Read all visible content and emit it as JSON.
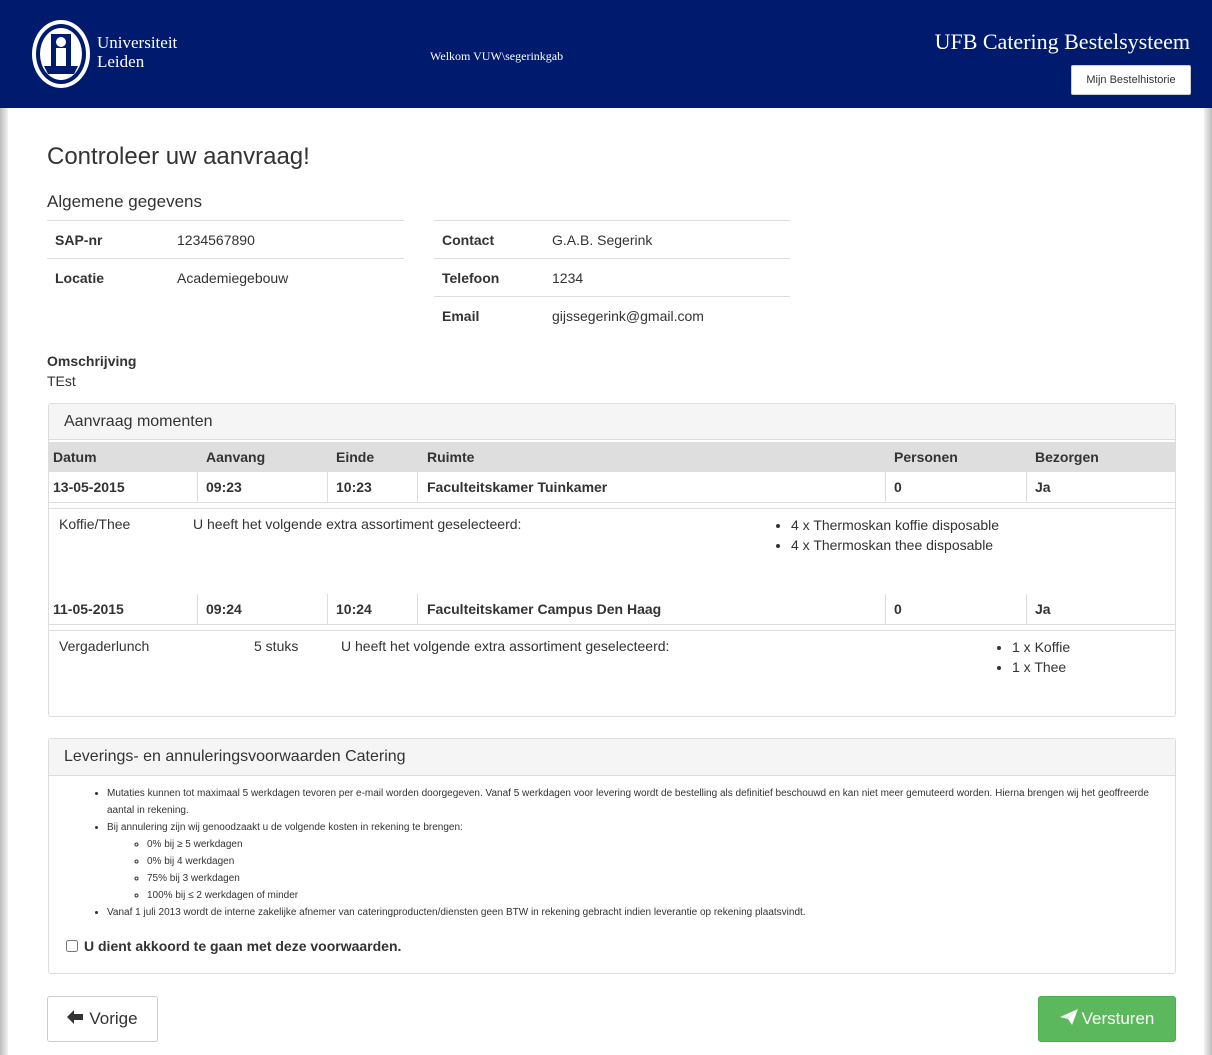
{
  "header": {
    "logo_line1": "Universiteit",
    "logo_line2": "Leiden",
    "welcome": "Welkom VUW\\segerinkgab",
    "app_title": "UFB Catering Bestelsysteem",
    "history_button": "Mijn Bestelhistorie",
    "bg_color": "#001b6e"
  },
  "page": {
    "title": "Controleer uw aanvraag!",
    "section_general": "Algemene gegevens"
  },
  "general": {
    "left": [
      {
        "label": "SAP-nr",
        "value": "1234567890"
      },
      {
        "label": "Locatie",
        "value": "Academiegebouw"
      }
    ],
    "right": [
      {
        "label": "Contact",
        "value": "G.A.B. Segerink"
      },
      {
        "label": "Telefoon",
        "value": "1234"
      },
      {
        "label": "Email",
        "value": "gijssegerink@gmail.com"
      }
    ]
  },
  "description": {
    "label": "Omschrijving",
    "value": "TEst"
  },
  "moments": {
    "heading": "Aanvraag momenten",
    "columns": [
      "Datum",
      "Aanvang",
      "Einde",
      "Ruimte",
      "Personen",
      "Bezorgen"
    ],
    "rows": [
      {
        "datum": "13-05-2015",
        "aanvang": "09:23",
        "einde": "10:23",
        "ruimte": "Faculteitskamer Tuinkamer",
        "personen": "0",
        "bezorgen": "Ja",
        "detail": {
          "type": "Koffie/Thee",
          "qty": "",
          "text": "U heeft het volgende extra assortiment geselecteerd:",
          "items": [
            "4 x Thermoskan koffie disposable",
            "4 x Thermoskan thee disposable"
          ]
        }
      },
      {
        "datum": "11-05-2015",
        "aanvang": "09:24",
        "einde": "10:24",
        "ruimte": "Faculteitskamer Campus Den Haag",
        "personen": "0",
        "bezorgen": "Ja",
        "detail": {
          "type": "Vergaderlunch",
          "qty": "5 stuks",
          "text": "U heeft het volgende extra assortiment geselecteerd:",
          "items": [
            "1 x Koffie",
            "1 x Thee"
          ]
        }
      }
    ]
  },
  "terms": {
    "heading": "Leverings- en annuleringsvoorwaarden Catering",
    "item1": "Mutaties kunnen tot maximaal 5 werkdagen tevoren per e-mail worden doorgegeven. Vanaf 5 werkdagen voor levering wordt de bestelling als definitief beschouwd en kan niet meer gemuteerd worden. Hierna brengen wij het geoffreerde aantal in rekening.",
    "item2": "Bij annulering zijn wij genoodzaakt u de volgende kosten in rekening te brengen:",
    "sub": [
      "0% bij ≥ 5 werkdagen",
      "0% bij 4 werkdagen",
      "75% bij 3 werkdagen",
      "100% bij ≤ 2 werkdagen of minder"
    ],
    "item3": "Vanaf 1 juli 2013 wordt de interne zakelijke afnemer van cateringproducten/diensten geen BTW in rekening gebracht indien leverantie op rekening plaatsvindt.",
    "agree": "U dient akkoord te gaan met deze voorwaarden.",
    "agree_checked": false
  },
  "buttons": {
    "prev": "Vorige",
    "send": "Versturen",
    "send_color": "#5cb85c"
  }
}
